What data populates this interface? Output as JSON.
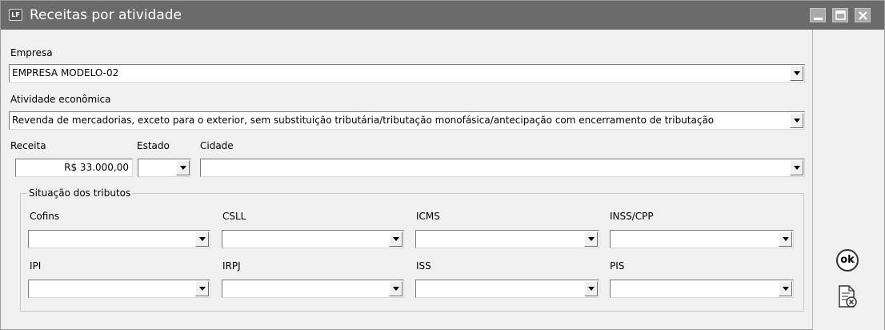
{
  "window": {
    "title": "Receitas por atividade",
    "app_icon_text": "LF",
    "controls": [
      "minimize-icon",
      "maximize-icon",
      "close-icon"
    ]
  },
  "form": {
    "empresa": {
      "label": "Empresa",
      "value": "EMPRESA MODELO-02"
    },
    "atividade": {
      "label": "Atividade econômica",
      "value": "Revenda de mercadorias, exceto para o exterior, sem substituição tributária/tributação monofásica/antecipação com encerramento de tributação"
    },
    "receita": {
      "label": "Receita",
      "value": "R$ 33.000,00"
    },
    "estado": {
      "label": "Estado",
      "value": ""
    },
    "cidade": {
      "label": "Cidade",
      "value": ""
    },
    "situacao": {
      "title": "Situação dos tributos",
      "tributos": [
        {
          "label": "Cofins",
          "value": ""
        },
        {
          "label": "CSLL",
          "value": ""
        },
        {
          "label": "ICMS",
          "value": ""
        },
        {
          "label": "INSS/CPP",
          "value": ""
        },
        {
          "label": "IPI",
          "value": ""
        },
        {
          "label": "IRPJ",
          "value": ""
        },
        {
          "label": "ISS",
          "value": ""
        },
        {
          "label": "PIS",
          "value": ""
        }
      ]
    }
  },
  "actions": {
    "ok_label": "ok",
    "ok_icon": "ok-circle-icon",
    "cancel_icon": "cancel-document-icon"
  }
}
